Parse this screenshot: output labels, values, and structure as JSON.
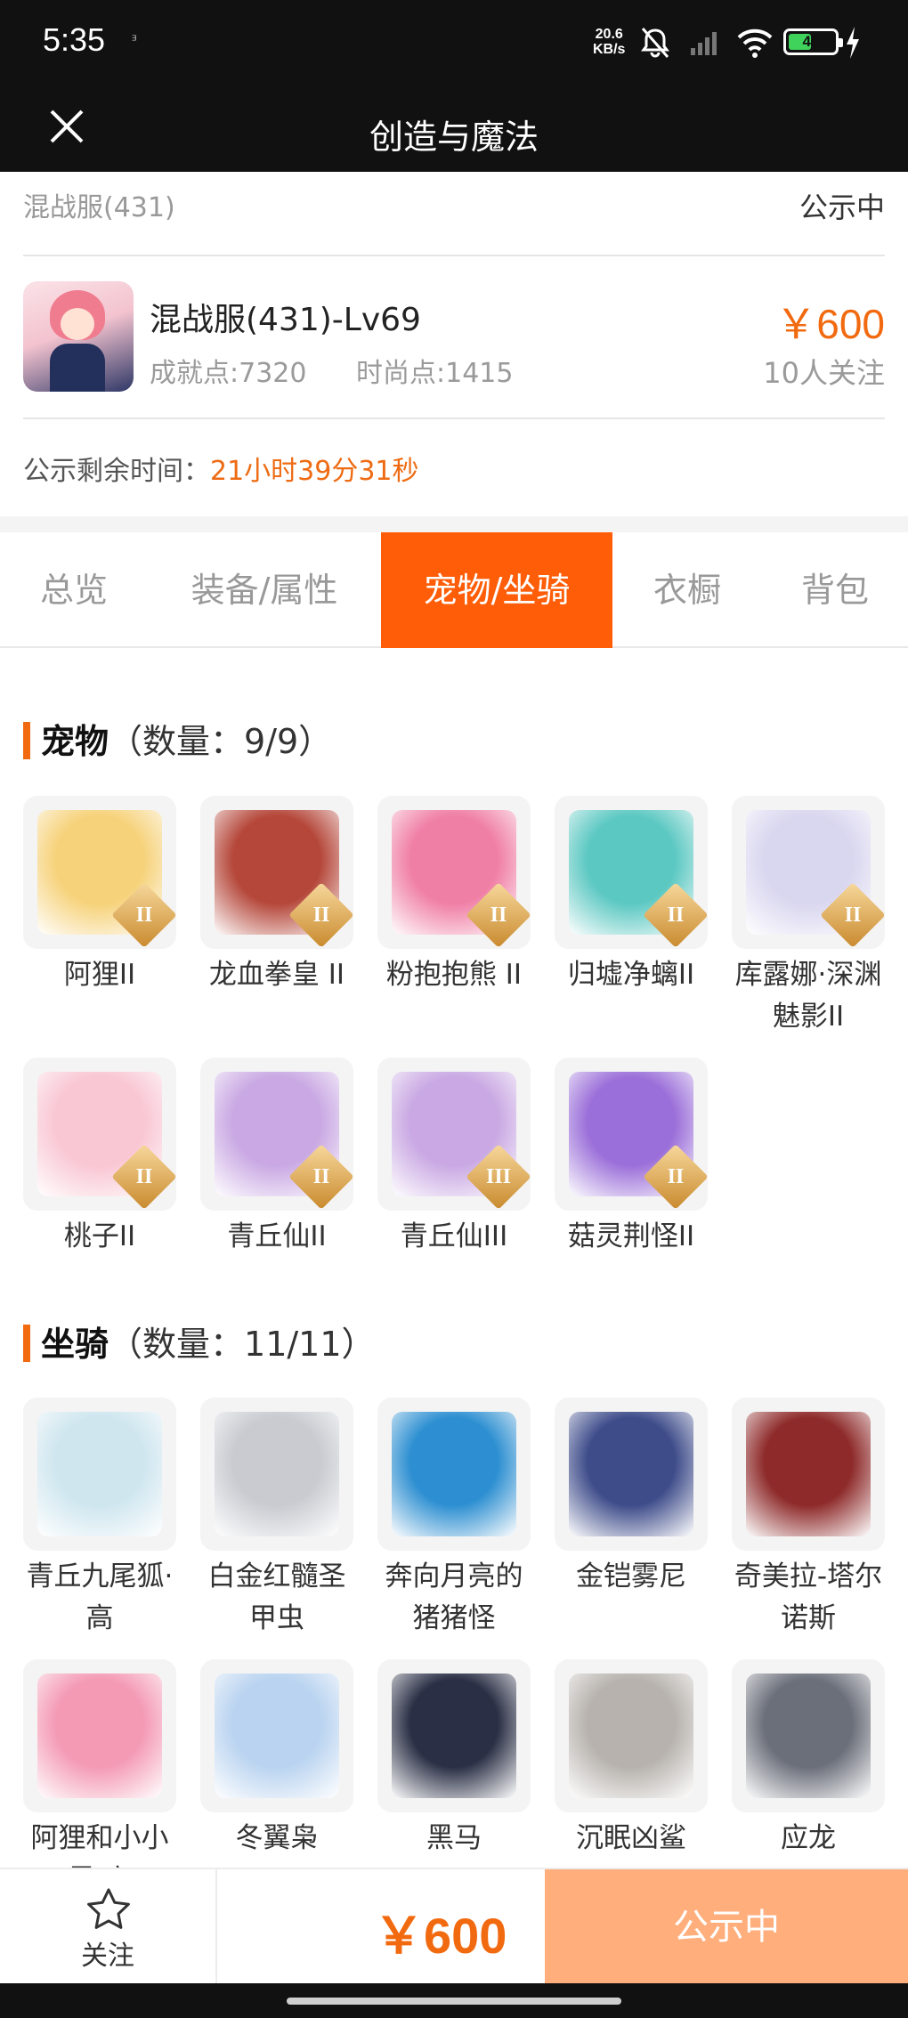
{
  "status_bar": {
    "time": "5:35",
    "time_sub": "ᴲ",
    "net_speed_value": "20.6",
    "net_speed_unit": "KB/s",
    "battery": "44",
    "battery_level": 0.44,
    "icons": [
      "mute-bell-icon",
      "signal-icon",
      "wifi-icon",
      "battery-icon",
      "charging-icon"
    ]
  },
  "header": {
    "title": "创造与魔法",
    "close_icon": "close-icon"
  },
  "server": {
    "name": "混战服(431)",
    "status": "公示中"
  },
  "role": {
    "name": "混战服(431)-Lv69",
    "achievement": "成就点:7320",
    "fashion": "时尚点:1415",
    "price": "￥600",
    "followers": "10人关注"
  },
  "countdown": {
    "label": "公示剩余时间：",
    "value": "21小时39分31秒"
  },
  "tabs": [
    {
      "label": "总览",
      "active": false
    },
    {
      "label": "装备/属性",
      "active": false
    },
    {
      "label": "宠物/坐骑",
      "active": true
    },
    {
      "label": "衣橱",
      "active": false
    },
    {
      "label": "背包",
      "active": false
    }
  ],
  "pets": {
    "title": "宠物",
    "count": "（数量：9/9）",
    "items": [
      {
        "name": "阿狸II",
        "tier": "II",
        "color": "#f6d27a"
      },
      {
        "name": "龙血拳皇 II",
        "tier": "II",
        "color": "#b5473a"
      },
      {
        "name": "粉抱抱熊 II",
        "tier": "II",
        "color": "#f07fa6"
      },
      {
        "name": "归墟净螭II",
        "tier": "II",
        "color": "#5cc8c2"
      },
      {
        "name": "库露娜·深渊魅影II",
        "tier": "II",
        "color": "#d9d6ef"
      },
      {
        "name": "桃子II",
        "tier": "II",
        "color": "#f9c6d3"
      },
      {
        "name": "青丘仙II",
        "tier": "II",
        "color": "#c9a8e3"
      },
      {
        "name": "青丘仙III",
        "tier": "III",
        "color": "#c9a8e3"
      },
      {
        "name": "菇灵荆怪II",
        "tier": "II",
        "color": "#9b6fd9"
      }
    ]
  },
  "mounts": {
    "title": "坐骑",
    "count": "（数量：11/11）",
    "items": [
      {
        "name": "青丘九尾狐·高",
        "color": "#cfe6ef"
      },
      {
        "name": "白金红髓圣甲虫",
        "color": "#c9cbd1"
      },
      {
        "name": "奔向月亮的猪猪怪",
        "color": "#2d8fd1"
      },
      {
        "name": "金铠雾尼",
        "color": "#3e4c8a"
      },
      {
        "name": "奇美拉-塔尔诺斯",
        "color": "#8e2a2a"
      },
      {
        "name": "阿狸和小小黑 高",
        "color": "#f49ab5"
      },
      {
        "name": "冬翼枭",
        "color": "#b9d3f0"
      },
      {
        "name": "黑马",
        "color": "#2a2f45"
      },
      {
        "name": "沉眠凶鲨",
        "color": "#b7b2ad"
      },
      {
        "name": "应龙",
        "color": "#6b6f7a"
      }
    ]
  },
  "bottom_bar": {
    "follow_icon": "star-outline-icon",
    "follow_label": "关注",
    "price": "￥600",
    "cta": "公示中"
  }
}
